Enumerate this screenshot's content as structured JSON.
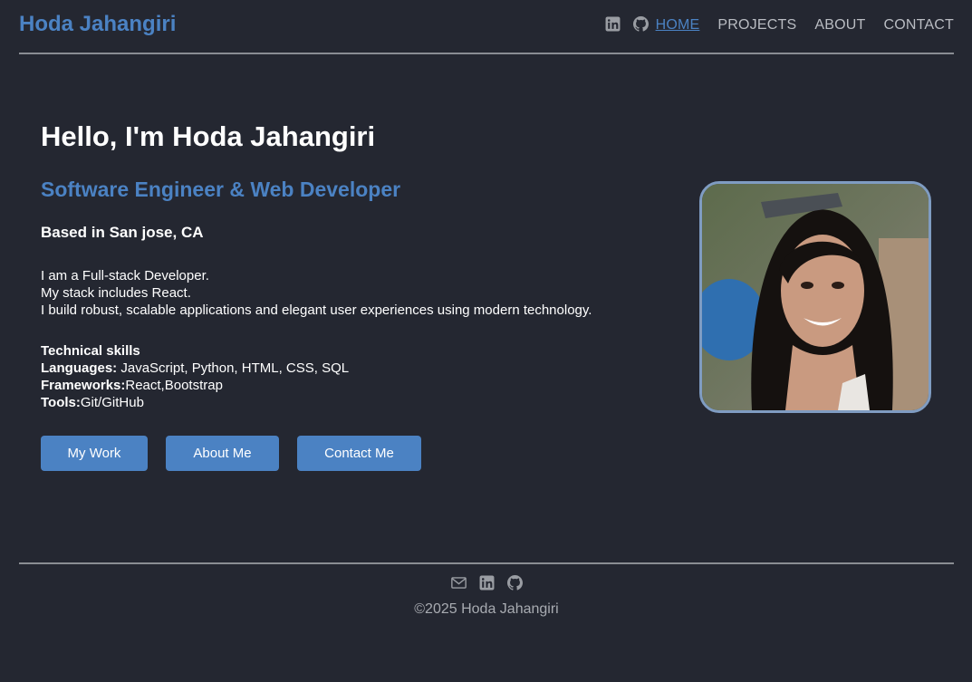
{
  "header": {
    "brand": "Hoda Jahangiri",
    "social": [
      "linkedin-icon",
      "github-icon"
    ],
    "nav": [
      {
        "label": "HOME",
        "active": true
      },
      {
        "label": "PROJECTS",
        "active": false
      },
      {
        "label": "ABOUT",
        "active": false
      },
      {
        "label": "CONTACT",
        "active": false
      }
    ]
  },
  "hero": {
    "title": "Hello, I'm Hoda Jahangiri",
    "subtitle": "Software Engineer & Web Developer",
    "location": "Based in San jose, CA",
    "intro": [
      "I am a Full-stack Developer.",
      "My stack includes React.",
      "I build robust, scalable applications and elegant user experiences using modern technology."
    ],
    "skills": {
      "heading": "Technical skills",
      "languages_label": "Languages:",
      "languages_value": " JavaScript, Python, HTML, CSS, SQL",
      "frameworks_label": "Frameworks:",
      "frameworks_value": "React,Bootstrap",
      "tools_label": "Tools:",
      "tools_value": "Git/GitHub"
    },
    "buttons": {
      "work": "My Work",
      "about": "About Me",
      "contact": "Contact Me"
    }
  },
  "footer": {
    "social": [
      "mail-icon",
      "linkedin-icon",
      "github-icon"
    ],
    "copyright": "©2025 Hoda Jahangiri"
  },
  "colors": {
    "background": "#242731",
    "accent": "#4b82c3",
    "muted": "#b9bcc2"
  }
}
